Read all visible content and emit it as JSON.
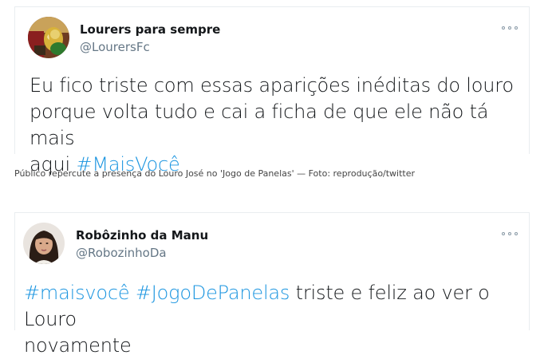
{
  "tweets": [
    {
      "user_name": "Lourers para sempre",
      "handle": "@LourersFc",
      "text_prefix": "Eu fico triste com essas aparições inéditas do louro\nporque volta tudo e cai a ficha de que ele não tá mais\naqui ",
      "hashtag1": "#MaisVocê",
      "accent": "#1b95e0"
    },
    {
      "user_name": "Robôzinho da Manu",
      "handle": "@RobozinhoDa",
      "hashtag1": "#maisvocê",
      "space": " ",
      "hashtag2": "#JogoDePanelas",
      "text_suffix": " triste e feliz ao ver o Louro\nnovamente",
      "accent": "#1b95e0"
    }
  ],
  "caption": "Público repercute a presença do Louro José no 'Jogo de Panelas' — Foto: reprodução/twitter"
}
